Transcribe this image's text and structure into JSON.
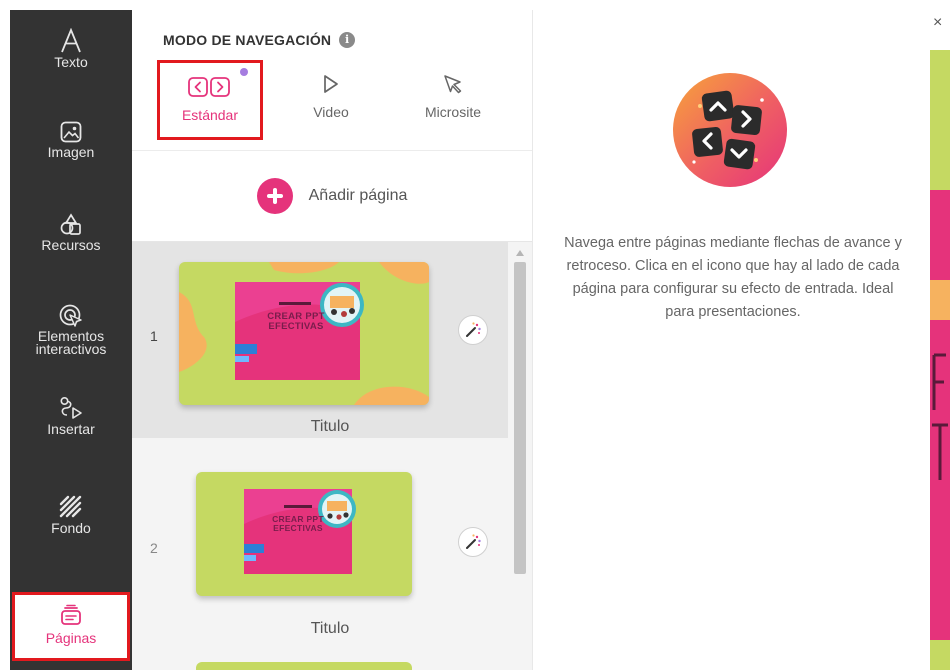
{
  "sidebar": {
    "items": [
      {
        "label": "Texto",
        "icon": "text-icon"
      },
      {
        "label": "Imagen",
        "icon": "image-icon"
      },
      {
        "label": "Recursos",
        "icon": "resources-icon"
      },
      {
        "label": "Elementos interactivos",
        "icon": "interactive-icon"
      },
      {
        "label": "Insertar",
        "icon": "insert-icon"
      },
      {
        "label": "Fondo",
        "icon": "background-icon"
      },
      {
        "label": "Páginas",
        "icon": "pages-icon",
        "active": true
      }
    ]
  },
  "navigation": {
    "title": "MODO DE NAVEGACIÓN",
    "info_glyph": "i",
    "modes": [
      {
        "label": "Estándar",
        "icon": "arrows-icon",
        "active": true
      },
      {
        "label": "Video",
        "icon": "play-icon"
      },
      {
        "label": "Microsite",
        "icon": "cursor-icon"
      }
    ]
  },
  "pages": {
    "add_label": "Añadir página",
    "items": [
      {
        "number": "1",
        "title": "Titulo",
        "thumb_text": "CREAR PPT EFECTIVAS",
        "selected": true
      },
      {
        "number": "2",
        "title": "Titulo",
        "thumb_text": "CREAR PPT EFECTIVAS",
        "selected": false
      }
    ]
  },
  "info": {
    "description": "Navega entre páginas mediante flechas de avance y retroceso. Clica en el icono que hay al lado de cada página para configurar su efecto de entrada. Ideal para presentaciones."
  },
  "canvas": {
    "close_glyph": "×"
  },
  "colors": {
    "accent": "#e5337b",
    "highlight_border": "#e2191e",
    "sidebar_bg": "#333333",
    "thumb_bg": "#c5d962"
  }
}
